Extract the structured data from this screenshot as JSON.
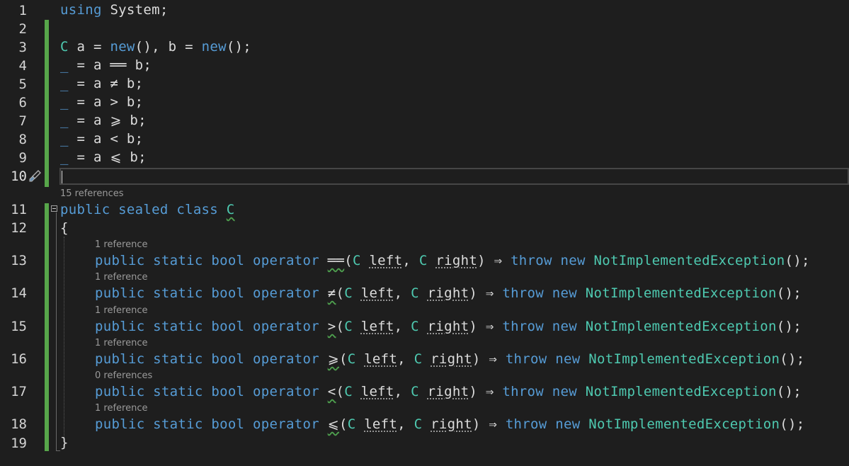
{
  "editor": {
    "line_numbers": [
      "1",
      "2",
      "3",
      "4",
      "5",
      "6",
      "7",
      "8",
      "9",
      "10",
      "11",
      "12",
      "13",
      "14",
      "15",
      "16",
      "17",
      "18",
      "19"
    ],
    "code": {
      "l1_kw": "using",
      "l1_rest": " System;",
      "l3_type": "C",
      "l3_a": " a = ",
      "l3_new1": "new",
      "l3_mid": "(), b = ",
      "l3_new2": "new",
      "l3_end": "();",
      "l4": "_ = a ══ b;",
      "l5": "_ = a ≠ b;",
      "l6": "_ = a > b;",
      "l7": "_ = a ⩾ b;",
      "l8": "_ = a < b;",
      "l9": "_ = a ⩽ b;",
      "l11_mods": "public sealed class ",
      "l11_name": "C",
      "l12": "{",
      "l19": "}",
      "op_prefix": "public static bool operator ",
      "op_eq": "══",
      "op_ne": "≠",
      "op_gt": ">",
      "op_ge": "⩾",
      "op_lt": "<",
      "op_le": "⩽",
      "param_open": "(",
      "param_type": "C",
      "param_left": "left",
      "param_comma": ", ",
      "param_right": "right",
      "param_close": ")",
      "arrow": " ⇒ ",
      "throw_kw": "throw",
      "new_kw": "new",
      "exception": "NotImplementedException",
      "tail": "();"
    },
    "codelens": {
      "class_refs": "15 references",
      "op_eq_refs": "1 reference",
      "op_ne_refs": "1 reference",
      "op_gt_refs": "1 reference",
      "op_ge_refs": "1 reference",
      "op_lt_refs": "0 references",
      "op_le_refs": "1 reference"
    },
    "icons": {
      "quick_action": "paintbrush-icon",
      "fold": "collapse-box-icon"
    },
    "colors": {
      "background": "#1e1e1e",
      "keyword": "#569cd6",
      "type": "#4ec9b0",
      "text": "#dcdcdc",
      "change_bar": "#57a64a"
    }
  }
}
